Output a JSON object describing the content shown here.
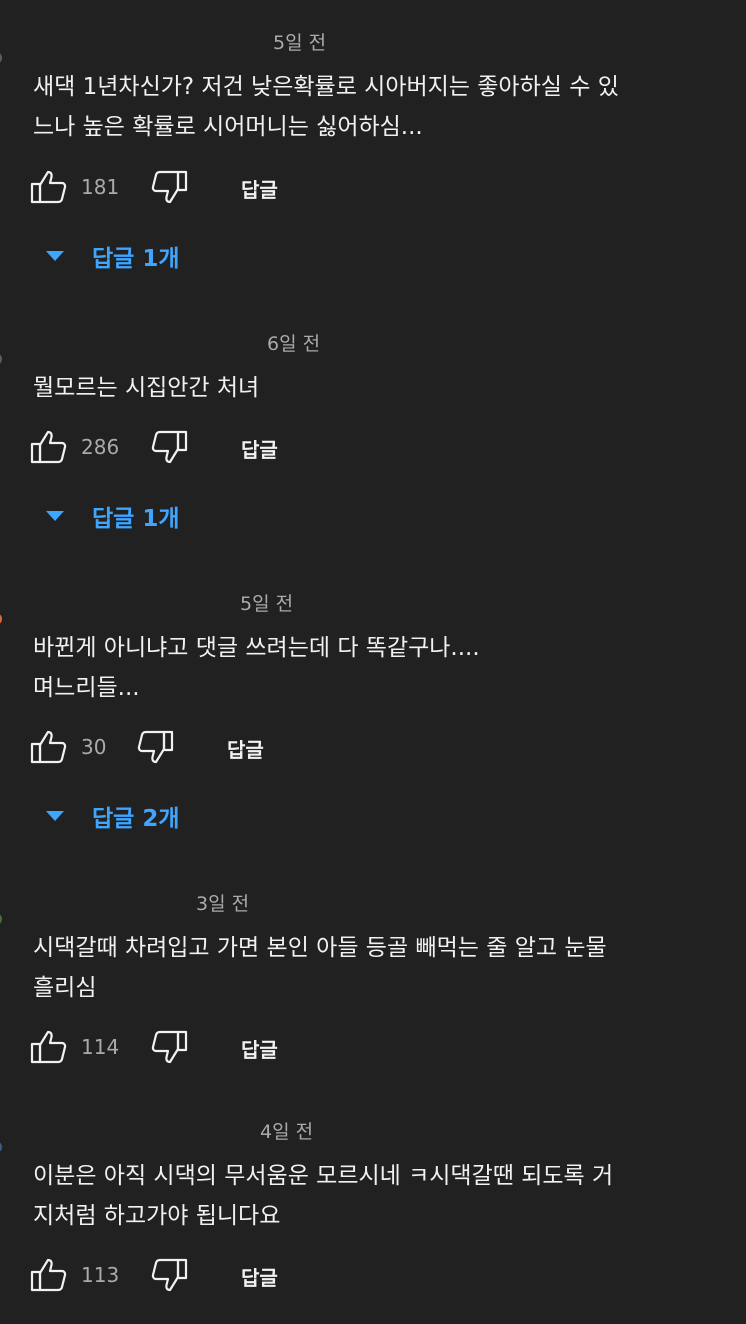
{
  "colors": {
    "background": "#212121",
    "text": "#f1f1f1",
    "muted": "#aaaaaa",
    "link": "#3ea6ff"
  },
  "icons": {
    "like": "thumbs-up-icon",
    "dislike": "thumbs-down-icon",
    "expand": "caret-down-icon"
  },
  "comments": [
    {
      "time": "5일 전",
      "text": "새댁 1년차신가? 저건 낮은확률로 시아버지는 좋아하실 수 있\n느나 높은 확률로 시어머니는 싫어하심...",
      "likes": "181",
      "reply_label": "답글",
      "replies_label": "답글 1개"
    },
    {
      "time": "6일 전",
      "text": "뭘모르는 시집안간 처녀",
      "likes": "286",
      "reply_label": "답글",
      "replies_label": "답글 1개"
    },
    {
      "time": "5일 전",
      "text": "바뀐게 아니냐고 댓글 쓰려는데 다 똑같구나....\n며느리들...",
      "likes": "30",
      "reply_label": "답글",
      "replies_label": "답글 2개"
    },
    {
      "time": "3일 전",
      "text": "시댁갈때 차려입고 가면 본인 아들 등골 빼먹는 줄 알고 눈물\n흘리심",
      "likes": "114",
      "reply_label": "답글"
    },
    {
      "time": "4일 전",
      "text": "이분은 아직 시댁의 무서움운 모르시네 ㅋ시댁갈땐 되도록 거\n지처럼 하고가야 됩니다요",
      "likes": "113",
      "reply_label": "답글"
    }
  ]
}
